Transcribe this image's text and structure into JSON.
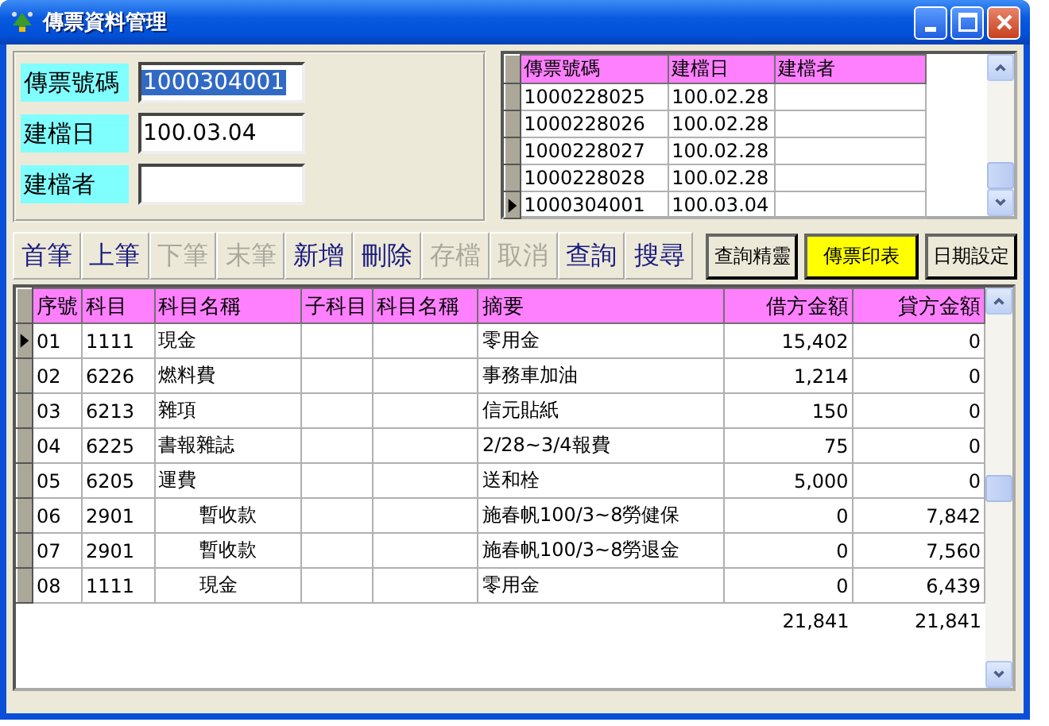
{
  "window": {
    "title": "傳票資料管理"
  },
  "header_fields": [
    {
      "label": "傳票號碼",
      "value": "1000304001",
      "highlighted": true
    },
    {
      "label": "建檔日",
      "value": "100.03.04",
      "highlighted": false
    },
    {
      "label": "建檔者"
    }
  ],
  "voucher_list": {
    "columns": [
      "傳票號碼",
      "建檔日",
      "建檔者"
    ],
    "rows": [
      {
        "cells": [
          "1000228025",
          "100.02.28",
          ""
        ],
        "current": false
      },
      {
        "cells": [
          "1000228026",
          "100.02.28",
          ""
        ],
        "current": false
      },
      {
        "cells": [
          "1000228027",
          "100.02.28",
          ""
        ],
        "current": false
      },
      {
        "cells": [
          "1000228028",
          "100.02.28",
          ""
        ],
        "current": false
      },
      {
        "cells": [
          "1000304001",
          "100.03.04",
          ""
        ],
        "current": true
      }
    ]
  },
  "toolbar": [
    {
      "label": "首筆",
      "kind": "nav",
      "disabled": false,
      "highlighted": false
    },
    {
      "label": "上筆",
      "kind": "nav",
      "disabled": false,
      "highlighted": false
    },
    {
      "label": "下筆",
      "kind": "nav",
      "disabled": true,
      "highlighted": false
    },
    {
      "label": "末筆",
      "kind": "nav",
      "disabled": true,
      "highlighted": false
    },
    {
      "label": "新增",
      "kind": "nav",
      "disabled": false,
      "highlighted": false
    },
    {
      "label": "刪除",
      "kind": "nav",
      "disabled": false,
      "highlighted": false
    },
    {
      "label": "存檔",
      "kind": "nav",
      "disabled": true,
      "highlighted": false
    },
    {
      "label": "取消",
      "kind": "nav",
      "disabled": true,
      "highlighted": false
    },
    {
      "label": "查詢",
      "kind": "nav",
      "disabled": false,
      "highlighted": false
    },
    {
      "label": "搜尋",
      "kind": "nav",
      "disabled": false,
      "highlighted": false
    },
    {
      "label": "查詢精靈",
      "kind": "framed",
      "disabled": false,
      "highlighted": false
    },
    {
      "label": "傳票印表",
      "kind": "framed",
      "disabled": false,
      "highlighted": true
    },
    {
      "label": "日期設定",
      "kind": "framed",
      "disabled": false,
      "highlighted": false
    }
  ],
  "entries": {
    "columns": [
      "序號",
      "科目",
      "科目名稱",
      "子科目",
      "科目名稱",
      "摘要",
      "借方金額",
      "貸方金額"
    ],
    "rows": [
      {
        "cells": [
          "01",
          "1111",
          "現金",
          "",
          "",
          "零用金",
          "15,402",
          "0"
        ],
        "current": true,
        "indented": false
      },
      {
        "cells": [
          "02",
          "6226",
          "燃料費",
          "",
          "",
          "事務車加油",
          "1,214",
          "0"
        ],
        "current": false,
        "indented": false
      },
      {
        "cells": [
          "03",
          "6213",
          "雜項",
          "",
          "",
          "信元貼紙",
          "150",
          "0"
        ],
        "current": false,
        "indented": false
      },
      {
        "cells": [
          "04",
          "6225",
          "書報雜誌",
          "",
          "",
          "2/28~3/4報費",
          "75",
          "0"
        ],
        "current": false,
        "indented": false
      },
      {
        "cells": [
          "05",
          "6205",
          "運費",
          "",
          "",
          "送和栓",
          "5,000",
          "0"
        ],
        "current": false,
        "indented": false
      },
      {
        "cells": [
          "06",
          "2901",
          "暫收款",
          "",
          "",
          "施春帆100/3~8勞健保",
          "0",
          "7,842"
        ],
        "current": false,
        "indented": true
      },
      {
        "cells": [
          "07",
          "2901",
          "暫收款",
          "",
          "",
          "施春帆100/3~8勞退金",
          "0",
          "7,560"
        ],
        "current": false,
        "indented": true
      },
      {
        "cells": [
          "08",
          "1111",
          "現金",
          "",
          "",
          "零用金",
          "0",
          "6,439"
        ],
        "current": false,
        "indented": true
      }
    ],
    "totals": {
      "debit": "21,841",
      "credit": "21,841"
    }
  }
}
